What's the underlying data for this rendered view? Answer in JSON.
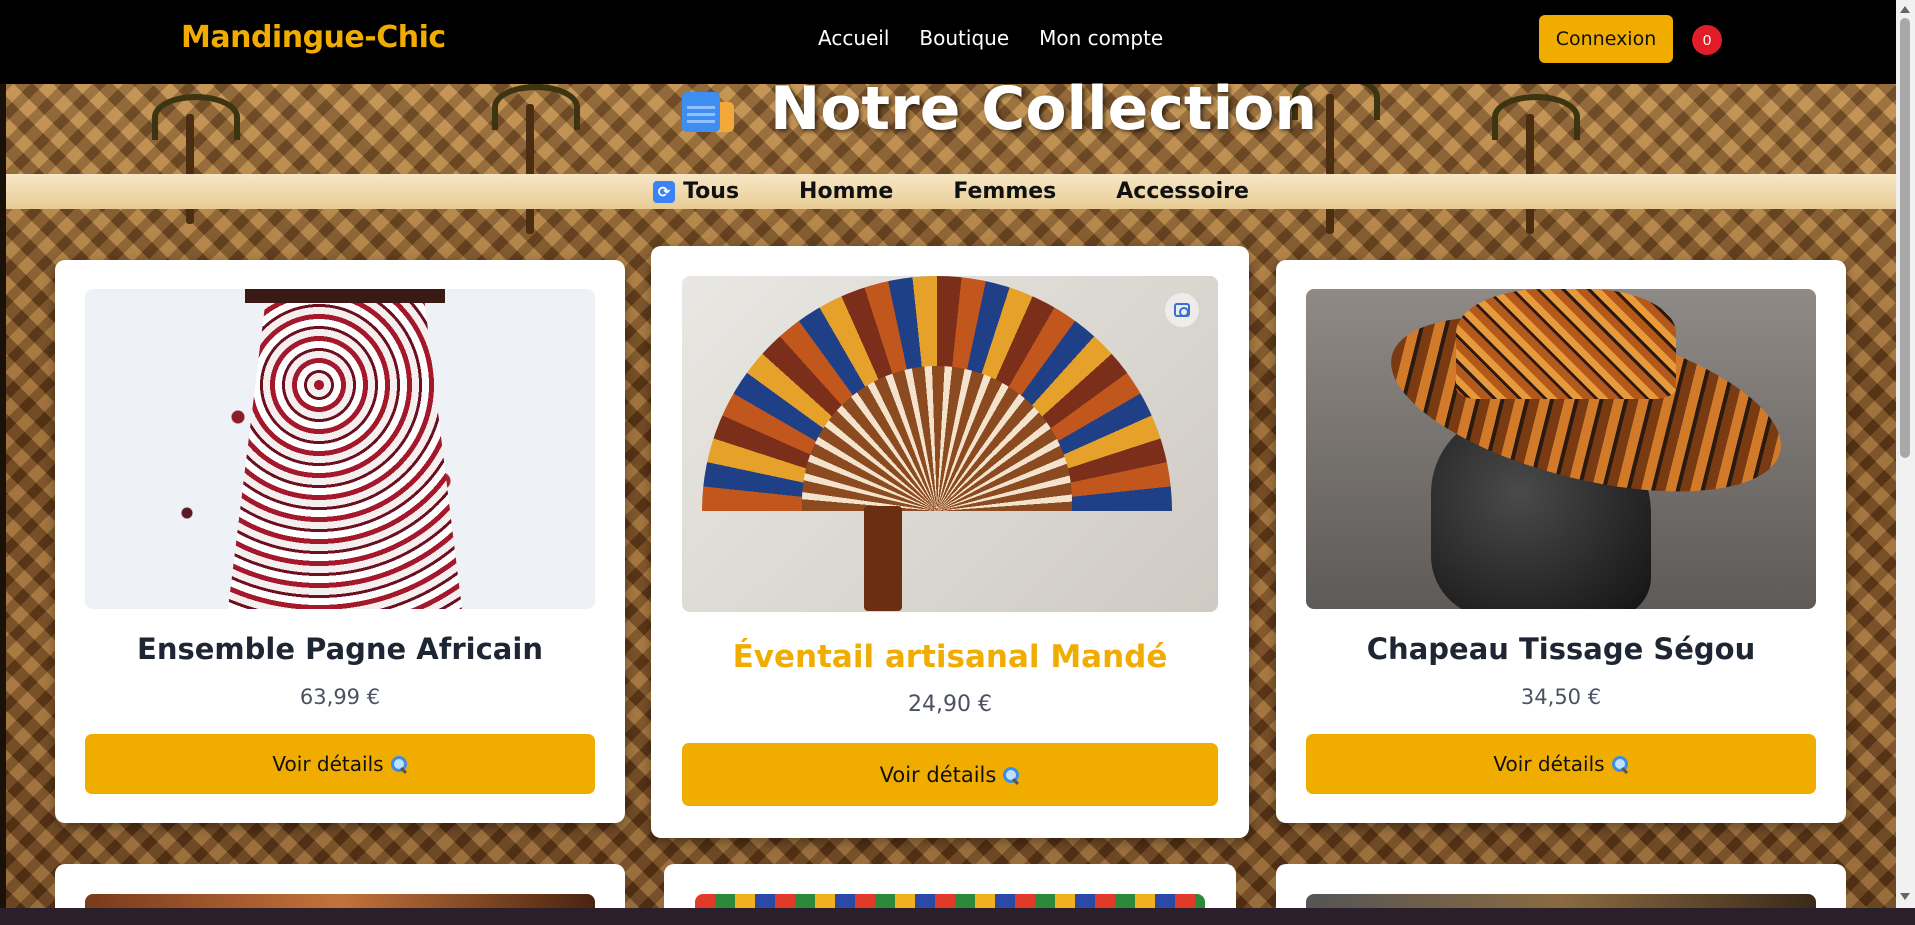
{
  "header": {
    "brand": "Mandingue-Chic",
    "nav": [
      "Accueil",
      "Boutique",
      "Mon compte"
    ],
    "login_label": "Connexion",
    "cart_count": "0"
  },
  "hero": {
    "title": "Notre Collection",
    "icon": "calendar-bookmark-icon"
  },
  "filters": [
    {
      "label": "Tous",
      "icon": "refresh-icon"
    },
    {
      "label": "Homme"
    },
    {
      "label": "Femmes"
    },
    {
      "label": "Accessoire"
    }
  ],
  "products": [
    {
      "title": "Ensemble Pagne Africain",
      "price": "63,99 €",
      "button": "Voir détails",
      "title_color": "#1e2533"
    },
    {
      "title": "Éventail artisanal Mandé",
      "price": "24,90 €",
      "button": "Voir détails",
      "title_color": "#f0ad00"
    },
    {
      "title": "Chapeau Tissage Ségou",
      "price": "34,50 €",
      "button": "Voir détails",
      "title_color": "#1e2533"
    }
  ],
  "colors": {
    "accent": "#f0ad00",
    "badge": "#e11d2a",
    "navbar": "#000000"
  }
}
